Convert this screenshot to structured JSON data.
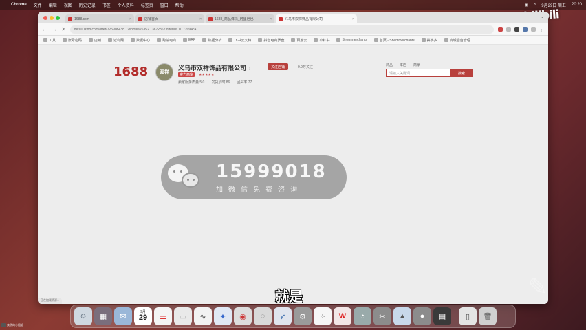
{
  "menubar": {
    "app": "Chrome",
    "items": [
      "文件",
      "编辑",
      "视图",
      "历史记录",
      "书签",
      "个人资料",
      "标签页",
      "窗口",
      "帮助"
    ],
    "date": "9月29日 周五",
    "time": "20:20"
  },
  "watermark_brand": "bilibili",
  "browser": {
    "tabs": [
      {
        "title": "1688.com"
      },
      {
        "title": "店铺首页"
      },
      {
        "title": "1688_商品详情_阿里巴巴"
      },
      {
        "title": "义乌市双祥饰品有限公司"
      }
    ],
    "url": "detail.1688.com/offer/725908438...?spm=a26352.13672862.offerlist.10.72094c4...",
    "bookmarks": [
      "工具",
      "账号密码",
      "店铺",
      "返利网",
      "数据中心",
      "跨境电商",
      "ERP",
      "数据分析",
      "飞书云文档",
      "抖音电商罗盘",
      "百度云",
      "小红书",
      "Shemmerchants",
      "首页 - Shemmerchants",
      "拼多多",
      "商城后台管理"
    ]
  },
  "page": {
    "logo": "1688",
    "shop": {
      "avatar_text": "双祥",
      "name": "义乌市双祥饰品有限公司",
      "follow_label": "关注店铺",
      "follow_count": "9.9万关注",
      "badge": "实力商家",
      "stats": [
        "卖家服务质量 5.0",
        "发货及时 86",
        "回头率 77"
      ]
    },
    "search": {
      "tabs": [
        "商品",
        "本店",
        "商家"
      ],
      "placeholder": "请输入关键词",
      "button": "搜索"
    },
    "overlay": {
      "number": "15999018",
      "subtitle": "加微信免费咨询"
    },
    "caption": "就是",
    "status": "正在加载资源..."
  },
  "dock": {
    "calendar_month": "9月",
    "calendar_day": "29",
    "apps": [
      "finder-icon",
      "launchpad-icon",
      "mail-icon",
      "calendar-icon",
      "reminders-icon",
      "notes-icon",
      "freeform-icon",
      "safari-icon",
      "chrome-icon",
      "wechat-icon",
      "feishu-icon",
      "settings-icon",
      "dingtalk-icon",
      "wps-icon",
      "qq-icon",
      "capcut-icon",
      "photos-icon",
      "screen-icon",
      "preview-icon",
      "trash-icon"
    ],
    "user_label": "卖货的小姐姐"
  },
  "colors": {
    "brand": "#b22d2b",
    "button": "#b8403c"
  }
}
